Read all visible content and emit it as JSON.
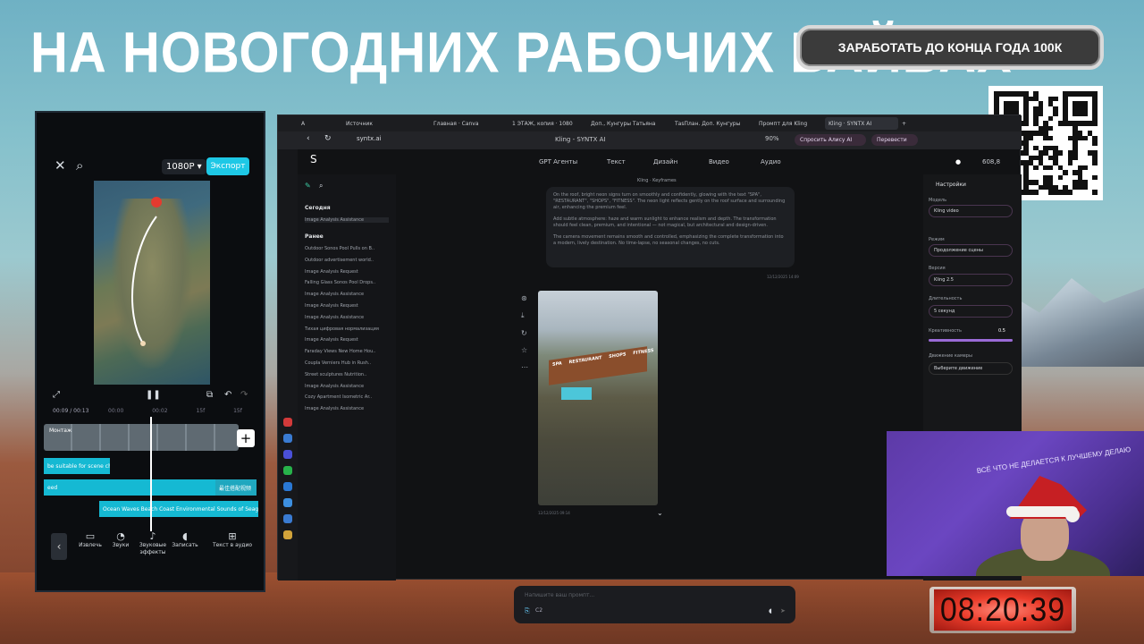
{
  "banner": {
    "title": "НА НОВОГОДНИХ РАБОЧИХ ВАЙБАХ"
  },
  "cta": {
    "label": "ЗАРАБОТАТЬ ДО КОНЦА ГОДА 100К"
  },
  "editor": {
    "resolution": "1080P ▾",
    "export_label": "Экспорт",
    "time_current": "00:09 / 00:13",
    "ticks": [
      "00:00",
      "00:02",
      "15f",
      "15f"
    ],
    "clip_label": "Монтаж",
    "track1": "be suitable for scene cha",
    "track2": "eed",
    "track2_right": "最佳搭配视频",
    "track3": "Ocean Waves Beach Coast Environmental Sounds of Seagu",
    "toolbar": [
      {
        "label": "Извлечь",
        "icon": "folder-icon",
        "glyph": "▭"
      },
      {
        "label": "Звуки",
        "icon": "timer-icon",
        "glyph": "◔"
      },
      {
        "label": "Звуковые эффекты",
        "icon": "music-note-icon",
        "glyph": "♪"
      },
      {
        "label": "Записать",
        "icon": "mic-icon",
        "glyph": "◖"
      },
      {
        "label": "Текст в аудио",
        "icon": "text-audio-icon",
        "glyph": "⊞"
      }
    ]
  },
  "browser": {
    "tabs": [
      "A",
      "Источник",
      "",
      "Главная · Canva",
      "1 ЭТАЖ, копия · 1080",
      "Доп., Кунгуры Татьяна",
      "ТаsПлан. Доп. Кунгуры",
      "Промпт для Kling",
      "Kling · SYNTX AI"
    ],
    "url": "syntx.ai",
    "page_title": "Kling - SYNTX AI",
    "zoom": "90%",
    "ask_alice": "Спросить Алису AI",
    "translate": "Перевести"
  },
  "app": {
    "nav": [
      "GPT Агенты",
      "Текст",
      "Дизайн",
      "Видео",
      "Аудио"
    ],
    "balance": "608,8",
    "chat_header": "Kling · Keyframes",
    "today_label": "Сегодня",
    "today_items": [
      "Image Analysis Assistance"
    ],
    "earlier_label": "Ранее",
    "earlier_items": [
      "Outdoor Sonos Pool Pulls on B..",
      "Outdoor advertisement world..",
      "Image Analysis Request",
      "Falling Glass Sonos Pool Drops..",
      "Image Analysis Assistance",
      "Image Analysis Request",
      "Image Analysis Assistance",
      "Тихая цифровая нормализация",
      "Image Analysis Request",
      "Faraday Views New Home Hou..",
      "Coupla Verniers Hub in Rush..",
      "Street sculptures Nutrition..",
      "Image Analysis Assistance",
      "Cozy Apartment Isometric Ar..",
      "Image Analysis Assistance"
    ],
    "prompt_paragraphs": [
      "On the roof, bright neon signs turn on smoothly and confidently, glowing with the text \"SPA\", \"RESTAURANT\", \"SHOPS\", \"FITNESS\". The neon light reflects gently on the roof surface and surrounding air, enhancing the premium feel.",
      "Add subtle atmosphere: haze and warm sunlight to enhance realism and depth. The transformation should feel clean, premium, and intentional — not magical, but architectural and design-driven.",
      "The camera movement remains smooth and controlled, emphasizing the complete transformation into a modern, lively destination. No time-lapse, no seasonal changes, no cuts."
    ],
    "prompt_time": "12/12/2025 14:09",
    "result_time": "12/12/2025 09:14",
    "render_sign": [
      "SPA",
      "RESTAURANT",
      "SHOPS",
      "FITNESS"
    ],
    "composer_placeholder": "Напишите ваш промпт...",
    "composer_model": "С2",
    "settings": {
      "title": "Настройки",
      "model_label": "Модель",
      "model_value": "Kling video",
      "mode_label": "Режим",
      "mode_value": "Продолжение сцены",
      "version_label": "Версия",
      "version_value": "Kling 2.5",
      "duration_label": "Длительность",
      "duration_value": "5 секунд",
      "creativity_label": "Креативность",
      "creativity_value": "0.5",
      "camera_label": "Движение камеры",
      "camera_value": "Выберите движение"
    }
  },
  "webcam": {
    "neon": "ВСЁ ЧТО НЕ ДЕЛАЕТСЯ К ЛУЧШЕМУ ДЕЛАЮ"
  },
  "clock": {
    "time": "08:20:39"
  },
  "colors": {
    "accent": "#1ec8e6",
    "cta_bg": "#3b3b3b",
    "clock_red": "#ea3b2a"
  }
}
